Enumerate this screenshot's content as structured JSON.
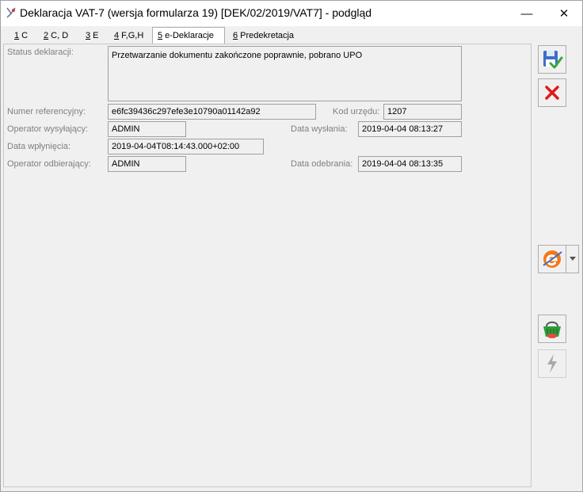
{
  "window": {
    "title": "Deklaracja VAT-7 (wersja formularza 19) [DEK/02/2019/VAT7] - podgląd",
    "minimize_glyph": "—",
    "close_glyph": "✕"
  },
  "tabs": [
    {
      "key": "1",
      "label": " C"
    },
    {
      "key": "2",
      "label": " C, D"
    },
    {
      "key": "3",
      "label": " E"
    },
    {
      "key": "4",
      "label": " F,G,H"
    },
    {
      "key": "5",
      "label": " e-Deklaracje",
      "active": true
    },
    {
      "key": "6",
      "label": " Predekretacja"
    }
  ],
  "form": {
    "status_label": "Status deklaracji:",
    "status_value": "Przetwarzanie dokumentu zakończone poprawnie, pobrano UPO",
    "ref_label": "Numer referencyjny:",
    "ref_value": "e6fc39436c297efe3e10790a01142a92",
    "office_label": "Kod urzędu:",
    "office_value": "1207",
    "sender_label": "Operator wysyłający:",
    "sender_value": "ADMIN",
    "sent_label": "Data wysłania:",
    "sent_value": "2019-04-04 08:13:27",
    "received_label": "Data wpłynięcia:",
    "received_value": "2019-04-04T08:14:43.000+02:00",
    "recipient_label": "Operator odbierający:",
    "recipient_value": "ADMIN",
    "collected_label": "Data odebrania:",
    "collected_value": "2019-04-04 08:13:35"
  },
  "toolbar": {
    "save_icon": "save-confirm-icon",
    "cancel_icon": "cancel-x-icon",
    "edeclaration_icon": "e-declaration-icon",
    "basket_icon": "basket-icon",
    "lightning_icon": "lightning-icon"
  },
  "colors": {
    "cancel_red": "#e01a1a",
    "check_green": "#3aa63a",
    "e_orange": "#f07a1a",
    "basket_green": "#2f9e3a"
  }
}
